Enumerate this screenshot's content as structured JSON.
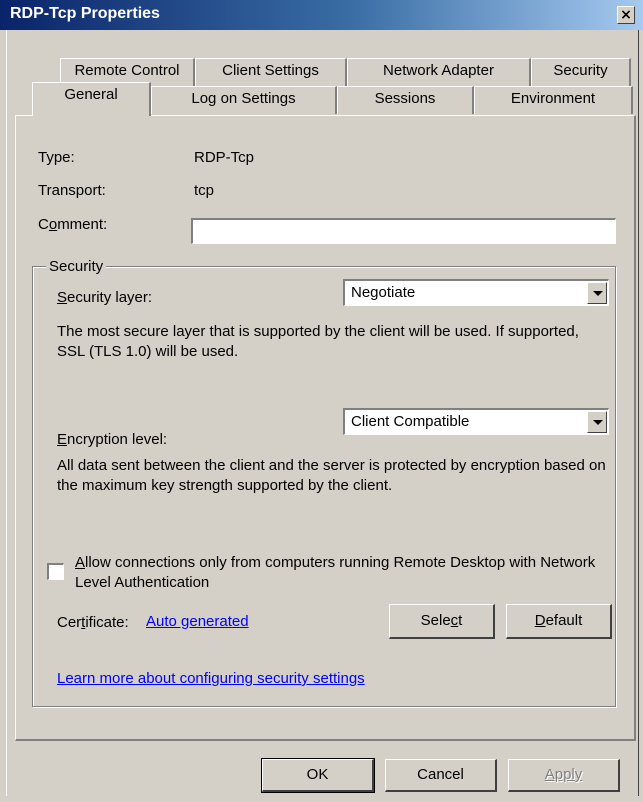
{
  "window": {
    "title": "RDP-Tcp Properties",
    "close_glyph": "×"
  },
  "tabs_row1": [
    "Remote Control",
    "Client Settings",
    "Network Adapter",
    "Security"
  ],
  "tabs_row2": [
    "General",
    "Log on Settings",
    "Sessions",
    "Environment"
  ],
  "active_tab": "General",
  "general": {
    "type_label": "Type:",
    "type_value": "RDP-Tcp",
    "transport_label": "Transport:",
    "transport_value": "tcp",
    "comment_label_pre": "C",
    "comment_label_u": "o",
    "comment_label_post": "mment:",
    "comment_value": ""
  },
  "security": {
    "group_label": "Security",
    "layer_label_u": "S",
    "layer_label_post": "ecurity layer:",
    "layer_value": "Negotiate",
    "layer_desc": "The most secure layer that is supported by the client will be used. If supported, SSL (TLS 1.0) will be used.",
    "enc_label_u": "E",
    "enc_label_post": "ncryption level:",
    "enc_value": "Client Compatible",
    "enc_desc": "All data sent between the client and the server is protected by encryption based on the maximum key strength supported by the client.",
    "nla_label_u": "A",
    "nla_label_post": "llow connections only from computers running Remote Desktop with Network Level Authentication",
    "nla_checked": false,
    "cert_label_pre": "Cer",
    "cert_label_u": "t",
    "cert_label_post": "ificate:",
    "cert_value": "Auto generated",
    "select_pre": "Sele",
    "select_u": "c",
    "select_post": "t",
    "default_u": "D",
    "default_post": "efault",
    "learn_more": "Learn more about configuring security settings"
  },
  "buttons": {
    "ok": "OK",
    "cancel": "Cancel",
    "apply": "Apply"
  },
  "colors": {
    "titlebar_start": "#0a246a",
    "dialog_bg": "#d4d0c8",
    "link": "#0000ff"
  }
}
